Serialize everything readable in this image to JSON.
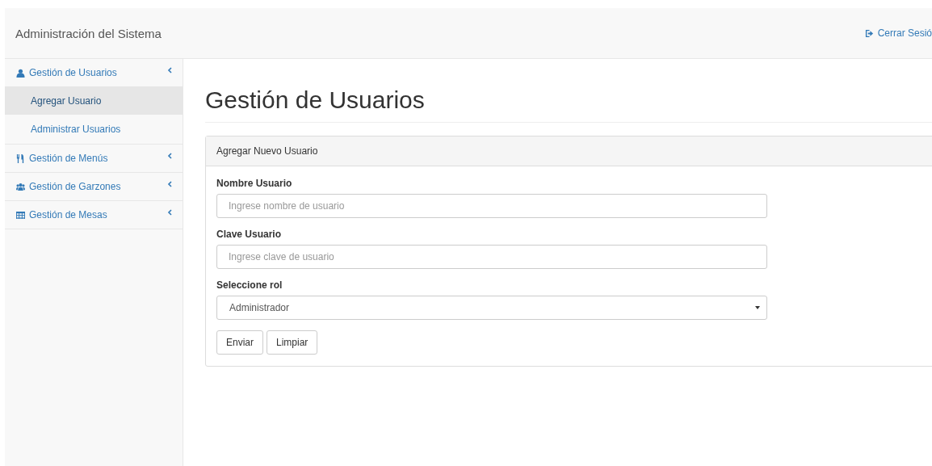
{
  "navbar": {
    "brand": "Administración del Sistema",
    "logout": "Cerrar Sesió"
  },
  "sidebar": {
    "items": [
      {
        "label": "Gestión de Usuarios",
        "children": [
          {
            "label": "Agregar Usuario",
            "selected": true
          },
          {
            "label": "Administrar Usuarios",
            "selected": false
          }
        ]
      },
      {
        "label": "Gestión de Menús"
      },
      {
        "label": "Gestión de Garzones"
      },
      {
        "label": "Gestión de Mesas"
      }
    ]
  },
  "page": {
    "title": "Gestión de Usuarios"
  },
  "panel": {
    "heading": "Agregar Nuevo Usuario",
    "fields": [
      {
        "kind": "text",
        "label": "Nombre Usuario",
        "placeholder": "Ingrese nombre de usuario"
      },
      {
        "kind": "text",
        "label": "Clave Usuario",
        "placeholder": "Ingrese clave de usuario"
      },
      {
        "kind": "select",
        "label": "Seleccione rol",
        "value": "Administrador"
      }
    ],
    "buttons": [
      "Enviar",
      "Limpiar"
    ]
  }
}
